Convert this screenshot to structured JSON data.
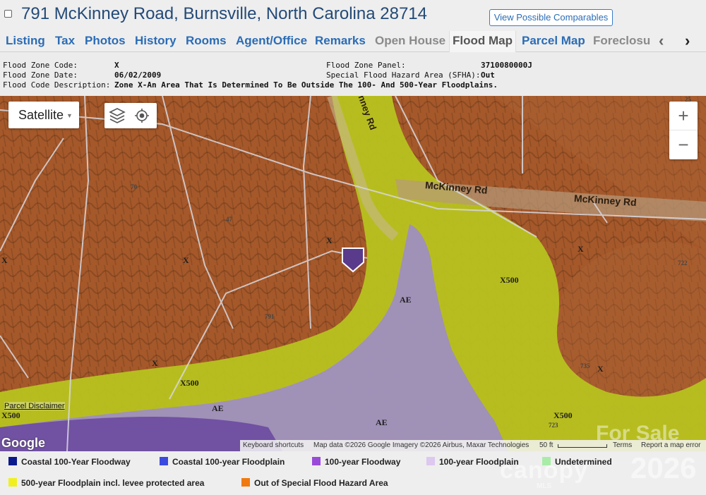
{
  "header": {
    "address": "791 McKinney Road, Burnsville, North Carolina 28714",
    "comparables_button": "View Possible Comparables"
  },
  "tabs": [
    "Listing",
    "Tax",
    "Photos",
    "History",
    "Rooms",
    "Agent/Office",
    "Remarks",
    "Open House",
    "Flood Map",
    "Parcel Map",
    "Foreclosu"
  ],
  "active_tab": "Flood Map",
  "info": {
    "zone_code_label": "Flood Zone Code:",
    "zone_code": "X",
    "zone_date_label": "Flood Zone Date:",
    "zone_date": "06/02/2009",
    "desc_label": "Flood Code Description:",
    "desc": "Zone X-An Area That Is Determined To Be Outside The 100- And 500-Year Floodplains.",
    "panel_label": "Flood Zone Panel:",
    "panel": "3710080000J",
    "sfha_label": "Special Flood Hazard Area (SFHA):",
    "sfha": "Out"
  },
  "map": {
    "type_control": "Satellite",
    "zoom_in": "+",
    "zoom_out": "−",
    "roads": [
      "McKinney Rd",
      "McKinney Rd",
      "Kinney Rd"
    ],
    "parcels": [
      "70",
      "47",
      "791",
      "722",
      "735",
      "723",
      "25"
    ],
    "zones": [
      "X",
      "X",
      "X",
      "X",
      "X",
      "X",
      "X500",
      "X500",
      "X500",
      "X500",
      "AE",
      "AE",
      "AE"
    ],
    "disclaimer": "Parcel Disclaimer",
    "google": "Google",
    "attribution": {
      "shortcuts": "Keyboard shortcuts",
      "data": "Map data ©2026 Google Imagery ©2026 Airbus, Maxar Technologies",
      "scale": "50 ft",
      "terms": "Terms",
      "report": "Report a map error"
    }
  },
  "legend": [
    {
      "label": "Coastal 100-Year Floodway",
      "color": "#0a1a8c"
    },
    {
      "label": "Coastal 100-year Floodplain",
      "color": "#3a4ae0"
    },
    {
      "label": "100-year Floodway",
      "color": "#9a4ad8"
    },
    {
      "label": "100-year Floodplain",
      "color": "#ddc8f0"
    },
    {
      "label": "Undetermined",
      "color": "#a8eca8"
    },
    {
      "label": "500-year Floodplain incl. levee protected area",
      "color": "#f0f020"
    },
    {
      "label": "Out of Special Flood Hazard Area",
      "color": "#f07a10"
    }
  ],
  "watermark": {
    "brand": "canopy",
    "sub": "MLS",
    "forsale": "For Sale",
    "year": "2026"
  }
}
